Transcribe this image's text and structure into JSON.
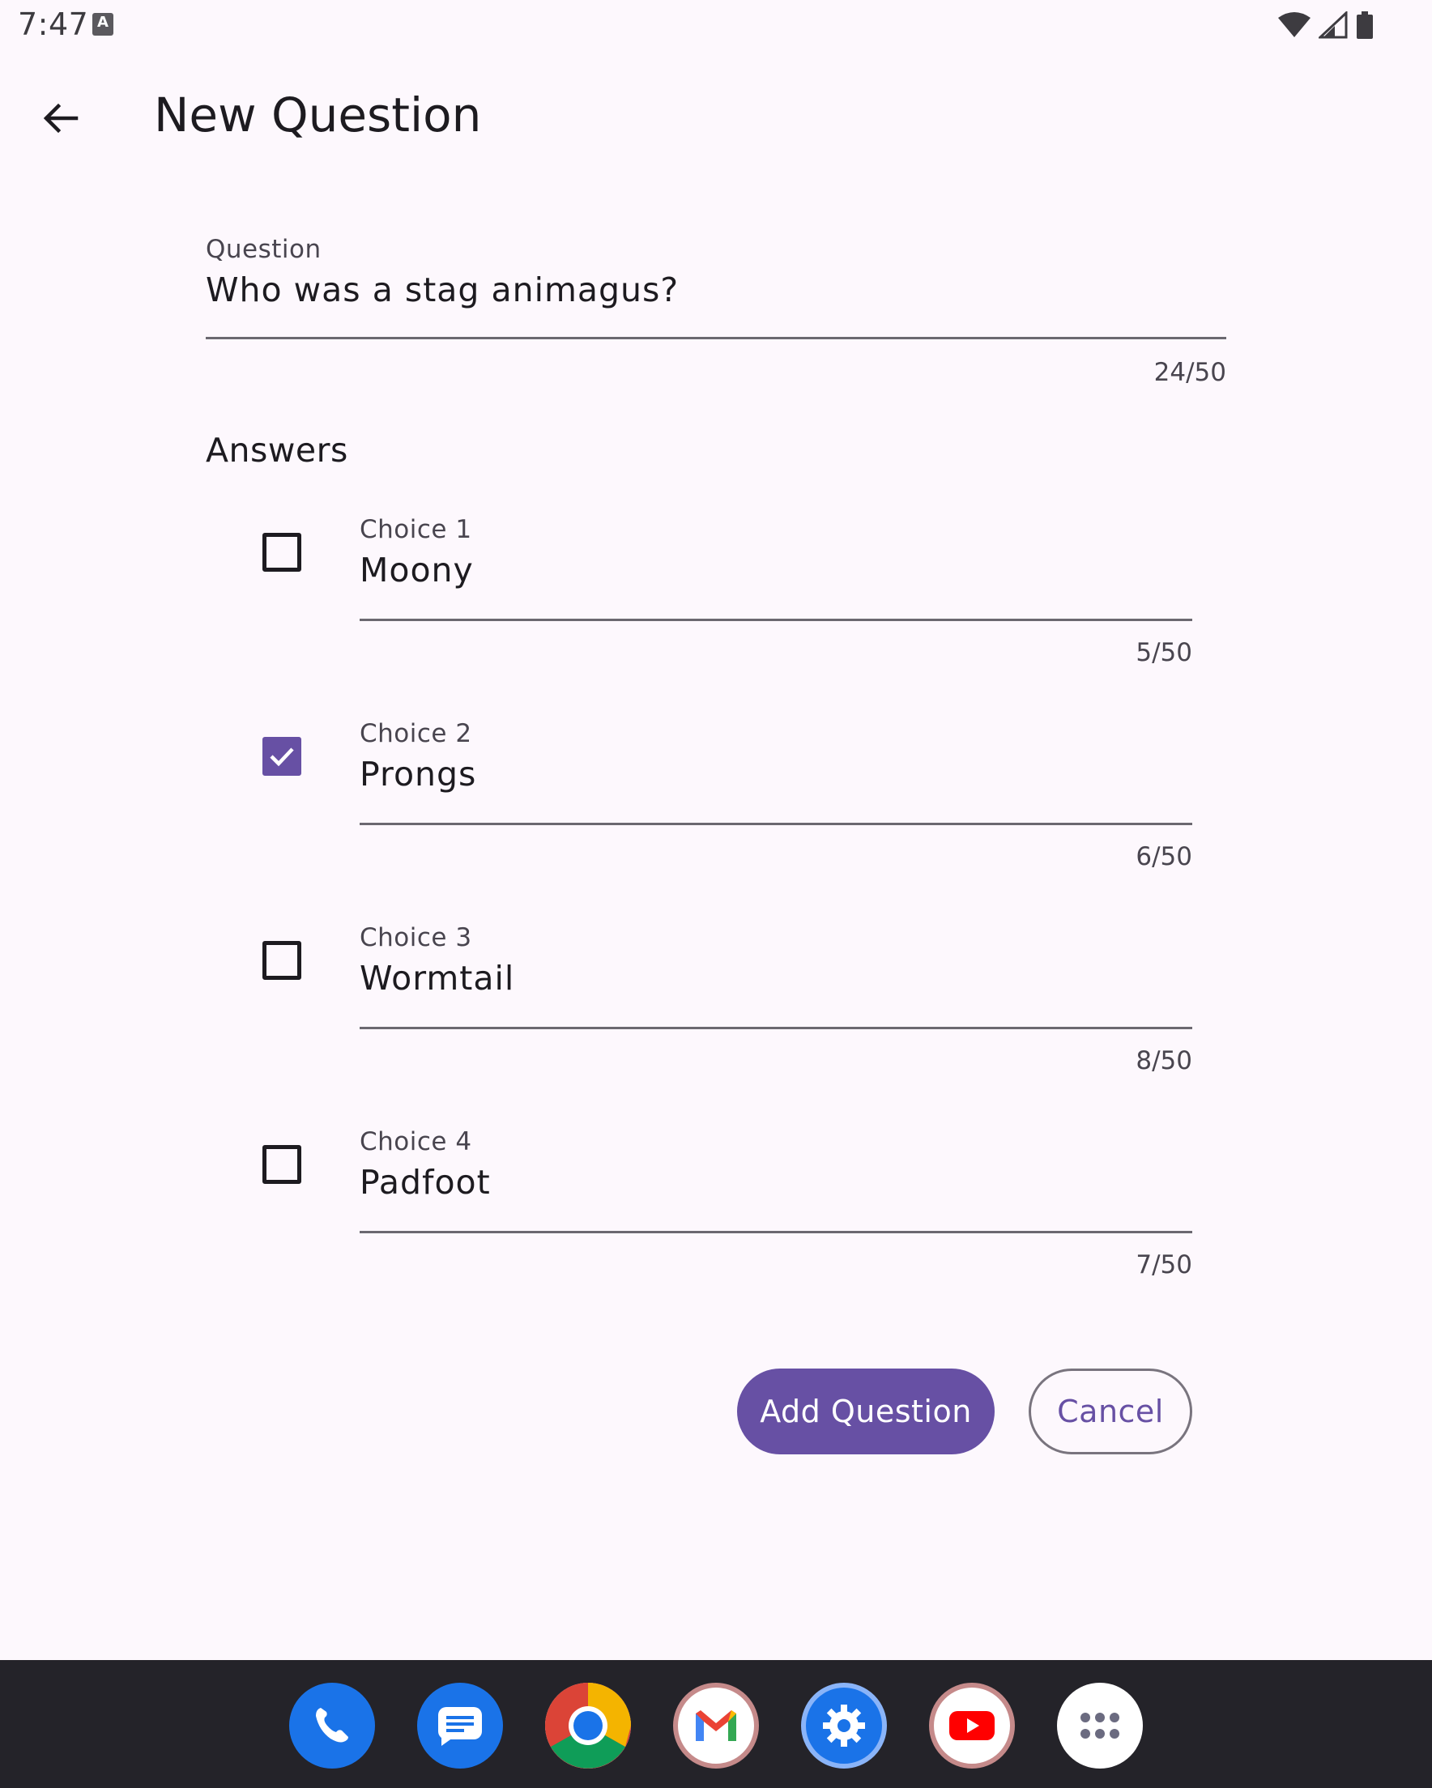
{
  "status_bar": {
    "time": "7:47",
    "notification_glyph": "A"
  },
  "app_bar": {
    "title": "New Question"
  },
  "question": {
    "label": "Question",
    "value": "Who was a stag animagus?",
    "counter": "24/50"
  },
  "answers": {
    "label": "Answers",
    "choices": [
      {
        "label": "Choice 1",
        "value": "Moony",
        "counter": "5/50",
        "checked": false
      },
      {
        "label": "Choice 2",
        "value": "Prongs",
        "counter": "6/50",
        "checked": true
      },
      {
        "label": "Choice 3",
        "value": "Wormtail",
        "counter": "8/50",
        "checked": false
      },
      {
        "label": "Choice 4",
        "value": "Padfoot",
        "counter": "7/50",
        "checked": false
      }
    ]
  },
  "actions": {
    "add_label": "Add Question",
    "cancel_label": "Cancel"
  },
  "dock": {
    "apps": [
      "phone-icon",
      "messages-icon",
      "chrome-icon",
      "gmail-icon",
      "settings-icon",
      "youtube-icon",
      "app-drawer-icon"
    ]
  },
  "colors": {
    "primary": "#6750a4",
    "background": "#fdf8fd",
    "dock": "#242329"
  }
}
